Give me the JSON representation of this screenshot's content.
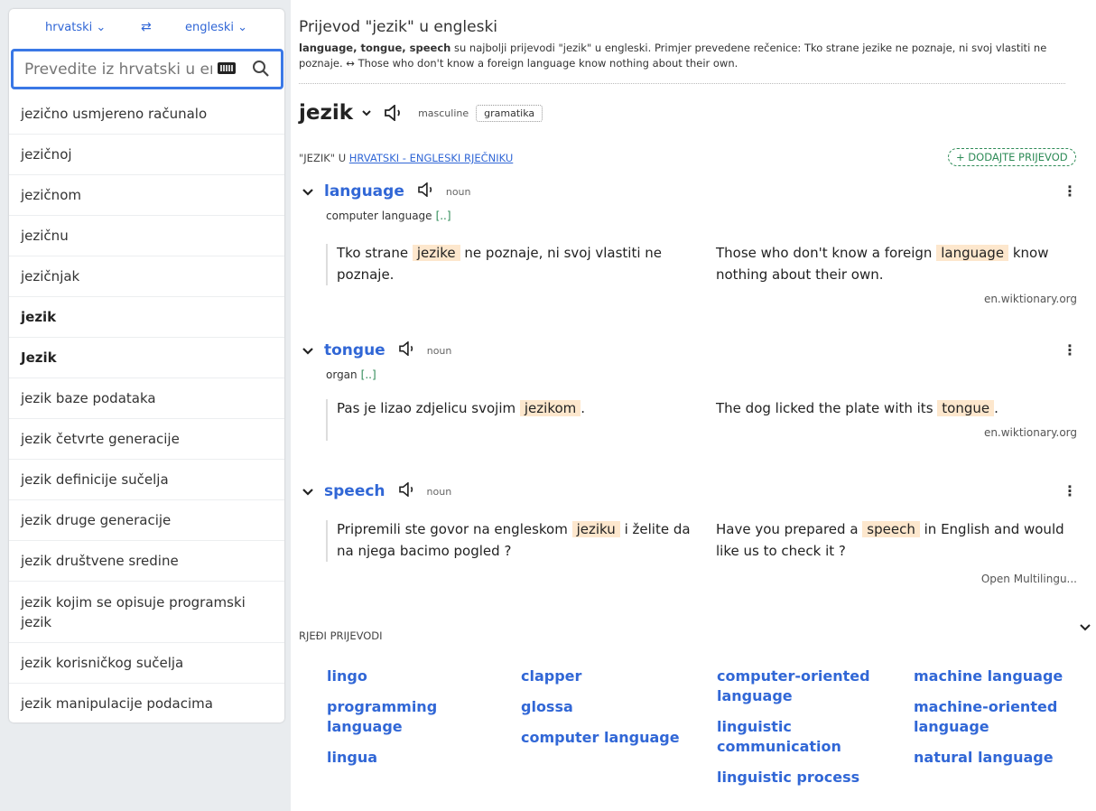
{
  "sidebar": {
    "lang_from": "hrvatski",
    "lang_to": "engleski",
    "search_placeholder": "Prevedite iz hrvatski u engleski",
    "items": [
      {
        "label": "jezično usmjereno računalo",
        "bold": false
      },
      {
        "label": "jezičnoj",
        "bold": false
      },
      {
        "label": "jezičnom",
        "bold": false
      },
      {
        "label": "jezičnu",
        "bold": false
      },
      {
        "label": "jezičnjak",
        "bold": false
      },
      {
        "label": "jezik",
        "bold": true
      },
      {
        "label": "Jezik",
        "bold": true
      },
      {
        "label": "jezik baze podataka",
        "bold": false
      },
      {
        "label": "jezik četvrte generacije",
        "bold": false
      },
      {
        "label": "jezik definicije sučelja",
        "bold": false
      },
      {
        "label": "jezik druge generacije",
        "bold": false
      },
      {
        "label": "jezik društvene sredine",
        "bold": false
      },
      {
        "label": "jezik kojim se opisuje programski jezik",
        "bold": false
      },
      {
        "label": "jezik korisničkog sučelja",
        "bold": false
      },
      {
        "label": "jezik manipulacije podacima",
        "bold": false
      }
    ]
  },
  "header": {
    "title": "Prijevod \"jezik\" u engleski",
    "desc_bold": "language, tongue, speech",
    "desc_rest": " su najbolji prijevodi \"jezik\" u engleski. Primjer prevedene rečenice: Tko strane jezike ne poznaje, ni svoj vlastiti ne poznaje. ↔ Those who don't know a foreign language know nothing about their own."
  },
  "headword": {
    "word": "jezik",
    "gender": "masculine",
    "grammar": "gramatika"
  },
  "dict": {
    "prefix": "\"JEZIK\" U ",
    "link": "HRVATSKI - ENGLESKI RJEČNIKU",
    "add_button": "+ DODAJTE PRIJEVOD"
  },
  "translations": [
    {
      "word": "language",
      "pos": "noun",
      "sub": "computer language",
      "more": "[..]",
      "src_before": "Tko strane ",
      "src_hl": "jezike",
      "src_after": " ne poznaje, ni svoj vlastiti ne poznaje.",
      "dst_before": "Those who don't know a foreign ",
      "dst_hl": "language",
      "dst_after": " know nothing about their own.",
      "ref": "en.wiktionary.org"
    },
    {
      "word": "tongue",
      "pos": "noun",
      "sub": "organ",
      "more": "[..]",
      "src_before": "Pas je lizao zdjelicu svojim ",
      "src_hl": "jezikom",
      "src_after": ".",
      "dst_before": "The dog licked the plate with its ",
      "dst_hl": "tongue",
      "dst_after": ".",
      "ref": "en.wiktionary.org"
    },
    {
      "word": "speech",
      "pos": "noun",
      "sub": "",
      "more": "",
      "src_before": "Pripremili ste govor na engleskom ",
      "src_hl": "jeziku",
      "src_after": " i želite da na njega bacimo pogled ?",
      "dst_before": "Have you prepared a ",
      "dst_hl": "speech",
      "dst_after": " in English and would like us to check it ?",
      "ref": "Open Multilingu..."
    }
  ],
  "rare": {
    "label": "RJEĐI PRIJEVODI",
    "col1": [
      "lingo",
      "programming language",
      "lingua"
    ],
    "col2": [
      "clapper",
      "glossa",
      "computer language"
    ],
    "col3": [
      "computer-oriented language",
      "linguistic communication",
      "linguistic process"
    ],
    "col4": [
      "machine language",
      "machine-oriented language",
      "natural language"
    ]
  }
}
